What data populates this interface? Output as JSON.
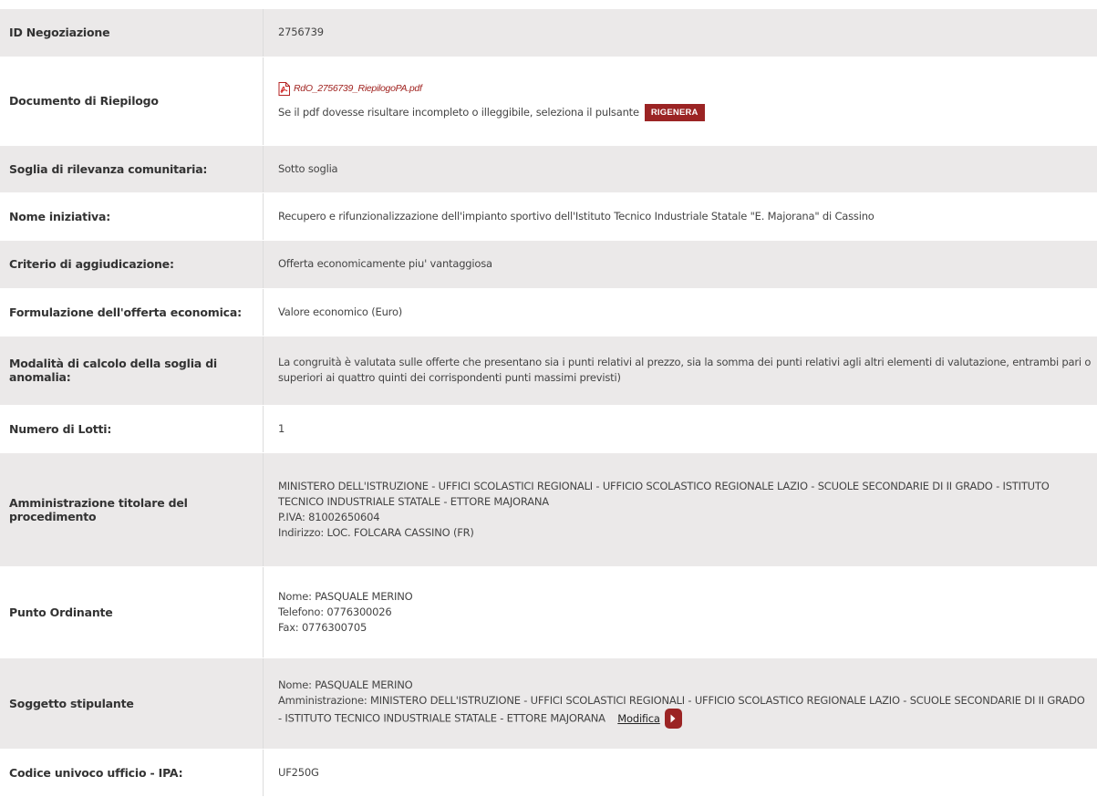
{
  "rows": {
    "id_negoziazione": {
      "label": "ID Negoziazione",
      "value": "2756739"
    },
    "documento": {
      "label": "Documento di Riepilogo",
      "file_name": "RdO_2756739_RiepilogoPA.pdf",
      "hint": "Se il pdf dovesse risultare incompleto o illeggibile, seleziona il pulsante",
      "button": "RIGENERA",
      "file_icon": "pdf-file-icon"
    },
    "soglia": {
      "label": "Soglia di rilevanza comunitaria:",
      "value": "Sotto soglia"
    },
    "nome_iniziativa": {
      "label": "Nome iniziativa:",
      "value": "Recupero e rifunzionalizzazione dell'impianto sportivo dell'Istituto Tecnico Industriale Statale \"E. Majorana\" di Cassino"
    },
    "criterio": {
      "label": "Criterio di aggiudicazione:",
      "value": "Offerta economicamente piu' vantaggiosa"
    },
    "formulazione": {
      "label": "Formulazione dell'offerta economica:",
      "value": "Valore economico (Euro)"
    },
    "modalita": {
      "label": "Modalità di calcolo della soglia di anomalia:",
      "line1": "La congruità è valutata sulle offerte che presentano sia i punti relativi al prezzo, sia la somma dei punti relativi agli altri elementi di valutazione, entrambi pari o",
      "line2": "superiori ai quattro quinti dei corrispondenti punti massimi previsti)"
    },
    "numero_lotti": {
      "label": "Numero di Lotti:",
      "value": "1"
    },
    "amministrazione": {
      "label": "Amministrazione titolare del procedimento",
      "line1": "MINISTERO DELL'ISTRUZIONE - UFFICI SCOLASTICI REGIONALI - UFFICIO SCOLASTICO REGIONALE LAZIO - SCUOLE SECONDARIE DI II GRADO - ISTITUTO",
      "line2": "TECNICO INDUSTRIALE STATALE - ETTORE MAJORANA",
      "piva": "P.IVA: 81002650604",
      "indirizzo": "Indirizzo: LOC. FOLCARA CASSINO (FR)"
    },
    "punto_ordinante": {
      "label": "Punto Ordinante",
      "nome": "Nome: PASQUALE MERINO",
      "telefono": "Telefono: 0776300026",
      "fax": "Fax: 0776300705"
    },
    "soggetto_stipulante": {
      "label": "Soggetto stipulante",
      "nome": "Nome: PASQUALE MERINO",
      "line1": "Amministrazione: MINISTERO DELL'ISTRUZIONE - UFFICI SCOLASTICI REGIONALI - UFFICIO SCOLASTICO REGIONALE LAZIO - SCUOLE SECONDARIE DI II GRADO",
      "line2": "- ISTITUTO TECNICO INDUSTRIALE STATALE - ETTORE MAJORANA",
      "modifica": "Modifica",
      "arrow_icon": "chevron-right-icon"
    },
    "codice_ipa": {
      "label": "Codice univoco ufficio - IPA:",
      "value": "UF250G"
    }
  },
  "colors": {
    "row_shade": "#ebe9e9",
    "accent": "#9b2424",
    "pdf_link": "#a0221f"
  }
}
